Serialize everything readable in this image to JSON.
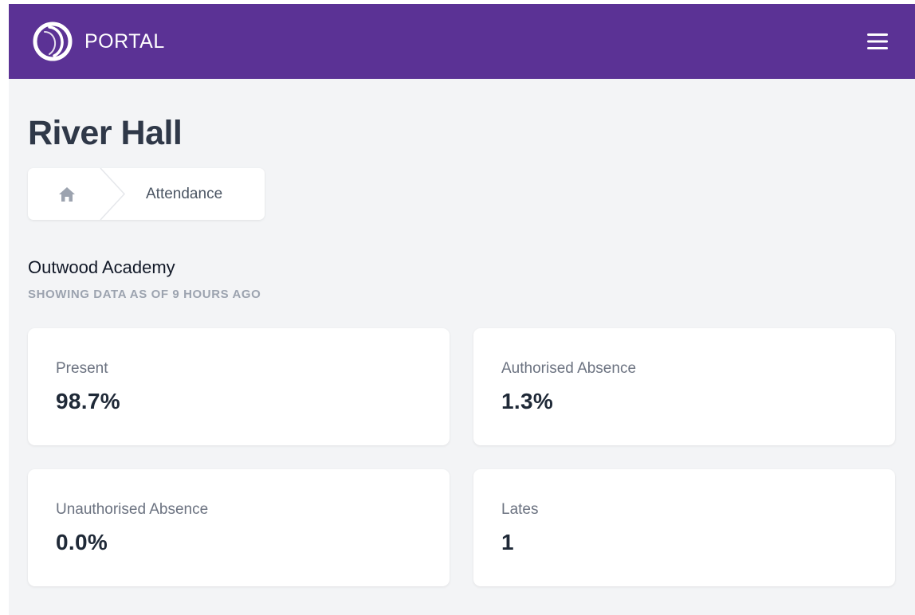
{
  "header": {
    "app_name": "PORTAL",
    "logo_icon": "portal-ring-logo",
    "menu_icon": "hamburger-menu-icon",
    "background_color": "#5b3295"
  },
  "page": {
    "title": "River Hall"
  },
  "breadcrumb": {
    "home_icon": "home-icon",
    "items": [
      {
        "label": "Attendance"
      }
    ]
  },
  "school": {
    "name": "Outwood Academy",
    "data_freshness": "SHOWING DATA AS OF 9 HOURS AGO"
  },
  "stats": [
    {
      "label": "Present",
      "value": "98.7%"
    },
    {
      "label": "Authorised Absence",
      "value": "1.3%"
    },
    {
      "label": "Unauthorised Absence",
      "value": "0.0%"
    },
    {
      "label": "Lates",
      "value": "1"
    }
  ]
}
